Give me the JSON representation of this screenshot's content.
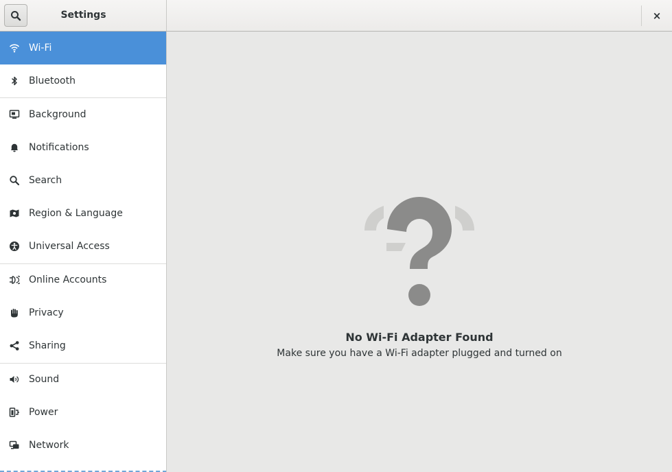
{
  "header": {
    "title": "Settings",
    "search_icon": "search-icon",
    "close_label": "×"
  },
  "sidebar": {
    "selected": "Wi-Fi",
    "items": [
      {
        "label": "Wi-Fi",
        "icon": "wifi-icon"
      },
      {
        "label": "Bluetooth",
        "icon": "bluetooth-icon"
      },
      {
        "label": "Background",
        "icon": "background-icon"
      },
      {
        "label": "Notifications",
        "icon": "bell-icon"
      },
      {
        "label": "Search",
        "icon": "search-icon"
      },
      {
        "label": "Region & Language",
        "icon": "region-icon"
      },
      {
        "label": "Universal Access",
        "icon": "accessibility-icon"
      },
      {
        "label": "Online Accounts",
        "icon": "online-accounts-icon"
      },
      {
        "label": "Privacy",
        "icon": "hand-icon"
      },
      {
        "label": "Sharing",
        "icon": "share-icon"
      },
      {
        "label": "Sound",
        "icon": "speaker-icon"
      },
      {
        "label": "Power",
        "icon": "power-icon"
      },
      {
        "label": "Network",
        "icon": "network-icon"
      }
    ]
  },
  "main": {
    "empty_icon": "wifi-question-icon",
    "empty_title": "No Wi-Fi Adapter Found",
    "empty_subtitle": "Make sure you have a Wi-Fi adapter plugged and turned on"
  },
  "colors": {
    "accent": "#4a90d9",
    "sidebar_bg": "#ffffff",
    "content_bg": "#e8e8e7"
  }
}
